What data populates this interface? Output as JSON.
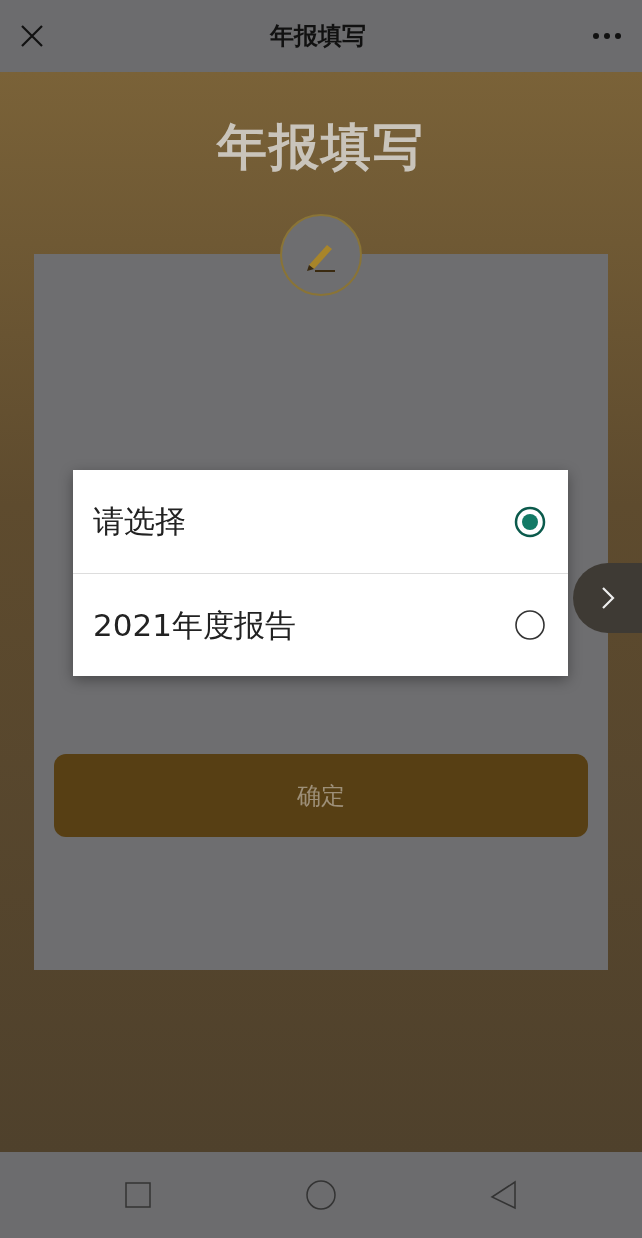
{
  "top_bar": {
    "title": "年报填写"
  },
  "banner": {
    "title": "年报填写"
  },
  "form": {
    "submit_button": "确定"
  },
  "picker": {
    "options": [
      {
        "label": "请选择",
        "selected": true
      },
      {
        "label": "2021年度报告",
        "selected": false
      }
    ]
  }
}
